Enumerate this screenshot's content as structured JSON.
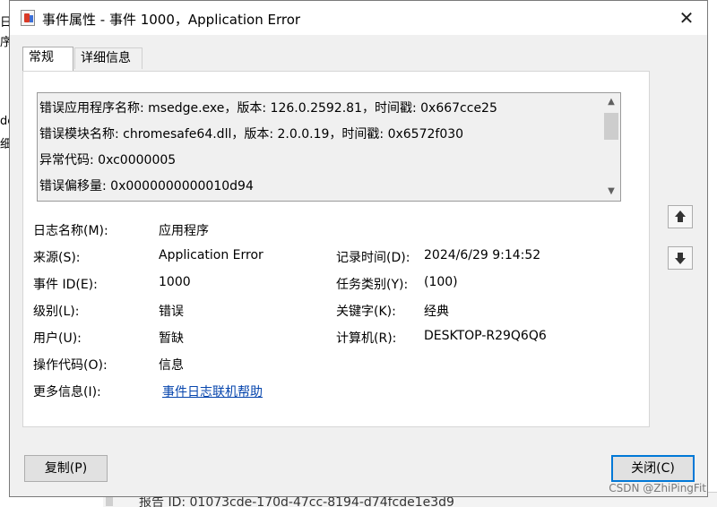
{
  "background": {
    "frag1": "日",
    "frag2": "序",
    "frag3": "de",
    "frag4": "细",
    "report_text": "报告 ID: 01073cde-170d-47cc-8194-d74fcde1e3d9"
  },
  "dialog": {
    "title": "事件属性 - 事件 1000，Application Error",
    "close_glyph": "✕",
    "tabs": [
      {
        "label": "常规"
      },
      {
        "label": "详细信息"
      }
    ],
    "description_lines": [
      "错误应用程序名称: msedge.exe，版本: 126.0.2592.81，时间戳: 0x667cce25",
      "错误模块名称: chromesafe64.dll，版本: 2.0.0.19，时间戳: 0x6572f030",
      "异常代码: 0xc0000005",
      "错误偏移量: 0x0000000000010d94"
    ],
    "fields": {
      "log_name_label": "日志名称(M):",
      "log_name_value": "应用程序",
      "source_label": "来源(S):",
      "source_value": "Application Error",
      "logged_label": "记录时间(D):",
      "logged_value": "2024/6/29 9:14:52",
      "event_id_label": "事件 ID(E):",
      "event_id_value": "1000",
      "task_category_label": "任务类别(Y):",
      "task_category_value": "(100)",
      "level_label": "级别(L):",
      "level_value": "错误",
      "keywords_label": "关键字(K):",
      "keywords_value": "经典",
      "user_label": "用户(U):",
      "user_value": "暂缺",
      "computer_label": "计算机(R):",
      "computer_value": "DESKTOP-R29Q6Q6",
      "opcode_label": "操作代码(O):",
      "opcode_value": "信息",
      "more_info_label": "更多信息(I):",
      "more_info_link": "事件日志联机帮助"
    },
    "buttons": {
      "copy": "复制(P)",
      "close": "关闭(C)"
    }
  },
  "watermark": "CSDN @ZhiPingFit"
}
